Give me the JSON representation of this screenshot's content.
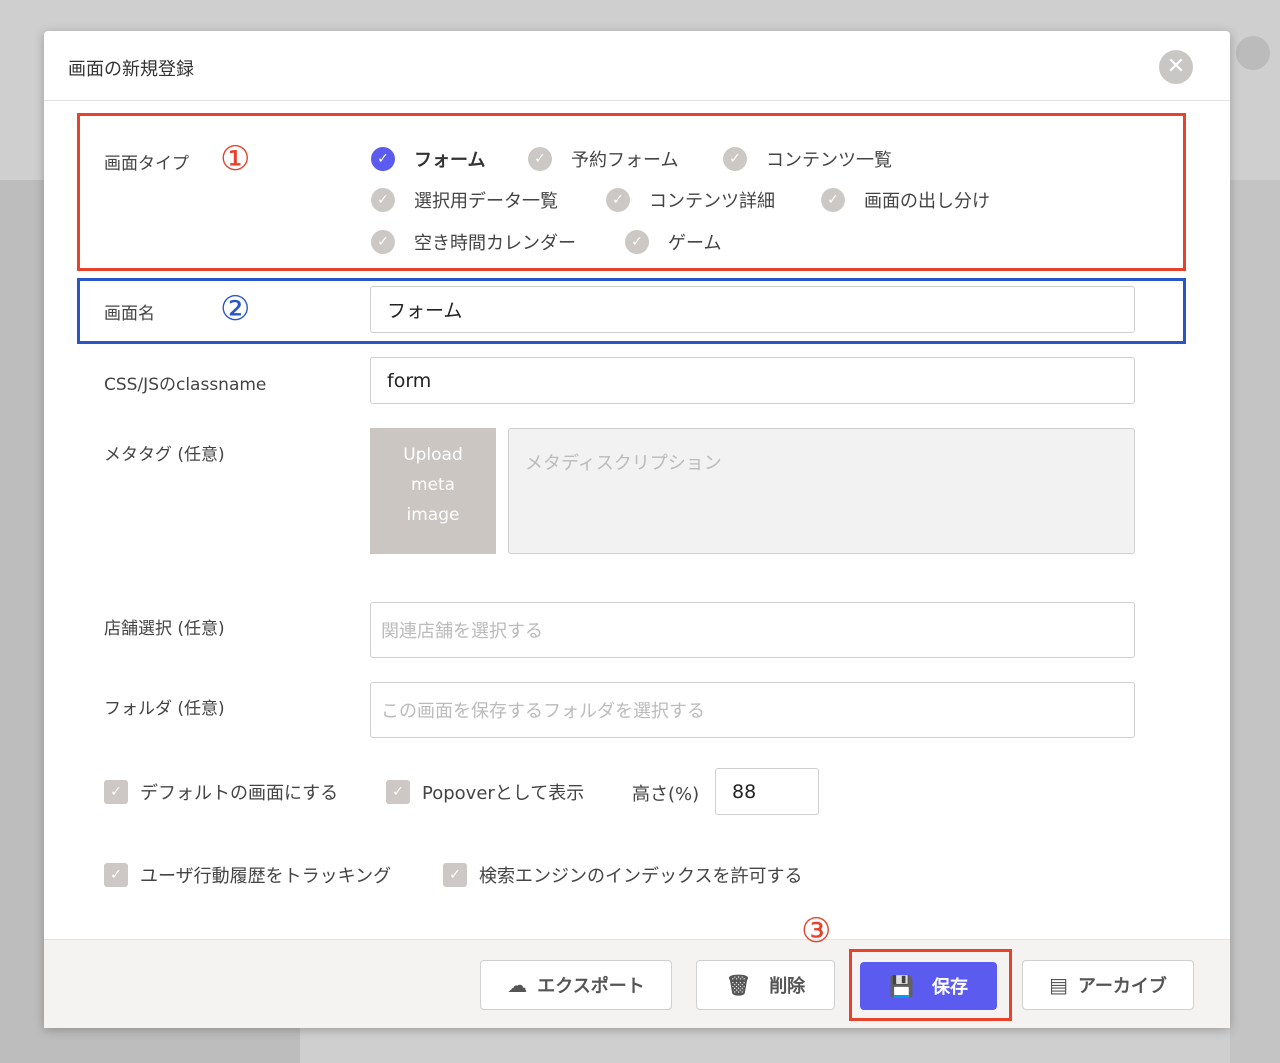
{
  "modal": {
    "title": "画面の新規登録",
    "close_glyph": "✕"
  },
  "markers": {
    "one": "①",
    "two": "②",
    "three": "③"
  },
  "screen_type": {
    "label": "画面タイプ",
    "options": [
      {
        "label": "フォーム",
        "selected": true
      },
      {
        "label": "予約フォーム",
        "selected": false
      },
      {
        "label": "コンテンツ一覧",
        "selected": false
      },
      {
        "label": "選択用データ一覧",
        "selected": false
      },
      {
        "label": "コンテンツ詳細",
        "selected": false
      },
      {
        "label": "画面の出し分け",
        "selected": false
      },
      {
        "label": "空き時間カレンダー",
        "selected": false
      },
      {
        "label": "ゲーム",
        "selected": false
      }
    ]
  },
  "screen_name": {
    "label": "画面名",
    "value": "フォーム"
  },
  "classname": {
    "label": "CSS/JSのclassname",
    "value": "form"
  },
  "meta": {
    "label": "メタタグ (任意)",
    "upload_line1": "Upload",
    "upload_line2": "meta",
    "upload_line3": "image",
    "description_placeholder": "メタディスクリプション"
  },
  "store": {
    "label": "店舗選択 (任意)",
    "placeholder": "関連店舗を選択する"
  },
  "folder": {
    "label": "フォルダ (任意)",
    "placeholder": "この画面を保存するフォルダを選択する"
  },
  "options": {
    "default_screen": "デフォルトの画面にする",
    "popover": "Popoverとして表示",
    "height_label": "高さ(%)",
    "height_value": "88",
    "tracking": "ユーザ行動履歴をトラッキング",
    "search_index": "検索エンジンのインデックスを許可する"
  },
  "footer": {
    "export": "エクスポート",
    "delete": "削除",
    "save": "保存",
    "archive": "アーカイブ"
  },
  "colors": {
    "accent": "#5b5bf0",
    "highlight_red": "#e8412c",
    "highlight_blue": "#2a55c8"
  }
}
